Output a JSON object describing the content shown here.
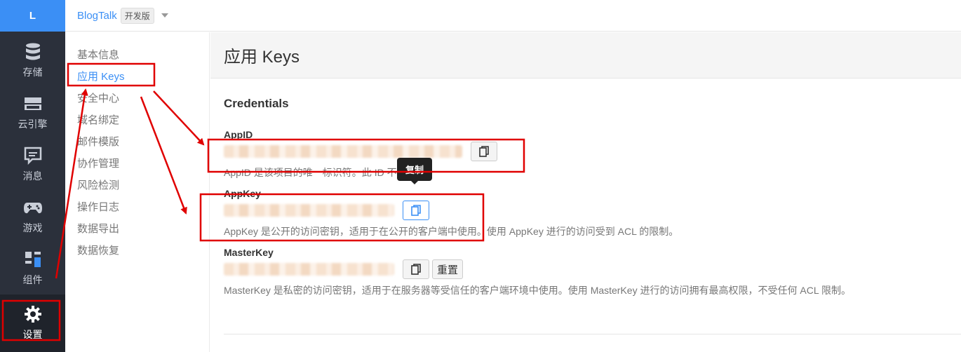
{
  "sidebar": {
    "logo": "L",
    "items": [
      {
        "label": "存储",
        "icon": "database-icon"
      },
      {
        "label": "云引擎",
        "icon": "server-icon"
      },
      {
        "label": "消息",
        "icon": "message-icon"
      },
      {
        "label": "游戏",
        "icon": "gamepad-icon"
      },
      {
        "label": "组件",
        "icon": "components-icon"
      },
      {
        "label": "设置",
        "icon": "gear-icon",
        "active": true
      }
    ]
  },
  "topbar": {
    "app_name": "BlogTalk",
    "app_badge": "开发版",
    "switch_icon": "caret-down-icon"
  },
  "subnav": {
    "items": [
      {
        "label": "基本信息"
      },
      {
        "label": "应用 Keys",
        "active": true
      },
      {
        "label": "安全中心"
      },
      {
        "label": "域名绑定"
      },
      {
        "label": "邮件模版"
      },
      {
        "label": "协作管理"
      },
      {
        "label": "风险检测"
      },
      {
        "label": "操作日志"
      },
      {
        "label": "数据导出"
      },
      {
        "label": "数据恢复"
      }
    ]
  },
  "main": {
    "page_title": "应用 Keys",
    "section_title": "Credentials",
    "appid": {
      "label": "AppID",
      "help": "AppID 是该项目的唯一标识符。此 ID 不可更改。"
    },
    "appkey": {
      "label": "AppKey",
      "help": "AppKey 是公开的访问密钥，适用于在公开的客户端中使用。使用 AppKey 进行的访问受到 ACL 的限制。"
    },
    "masterkey": {
      "label": "MasterKey",
      "help": "MasterKey 是私密的访问密钥，适用于在服务器等受信任的客户端环境中使用。使用 MasterKey 进行的访问拥有最高权限，不受任何 ACL 限制。",
      "reset_label": "重置"
    },
    "copy_tooltip": "复制",
    "copy_icon": "copy-icon"
  },
  "colors": {
    "accent": "#3b8ff5",
    "sidebar_bg": "#2b303b",
    "annotation": "#e00000"
  }
}
